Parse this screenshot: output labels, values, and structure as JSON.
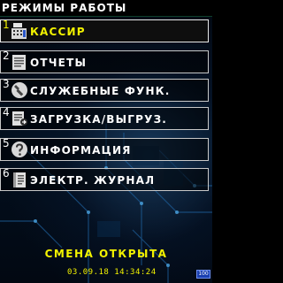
{
  "header": {
    "title": "РЕЖИМЫ РАБОТЫ"
  },
  "menu": {
    "items": [
      {
        "number": "1",
        "label": "КАССИР",
        "icon": "cash-register-icon",
        "selected": true
      },
      {
        "number": "2",
        "label": "ОТЧЕТЫ",
        "icon": "report-document-icon",
        "selected": false
      },
      {
        "number": "3",
        "label": "СЛУЖЕБНЫЕ ФУНК.",
        "icon": "wrench-icon",
        "selected": false
      },
      {
        "number": "4",
        "label": "ЗАГРУЗКА/ВЫГРУЗ.",
        "icon": "upload-download-icon",
        "selected": false
      },
      {
        "number": "5",
        "label": "ИНФОРМАЦИЯ",
        "icon": "question-icon",
        "selected": false
      },
      {
        "number": "6",
        "label": "ЭЛЕКТР. ЖУРНАЛ",
        "icon": "journal-icon",
        "selected": false
      }
    ]
  },
  "status": {
    "shift_text": "СМЕНА ОТКРЫТА",
    "datetime": "03.09.18 14:34:24",
    "battery_percent": "100"
  },
  "colors": {
    "accent": "#f2f200",
    "text": "#ffffff",
    "background": "#000000",
    "battery": "#1a3fb0"
  }
}
